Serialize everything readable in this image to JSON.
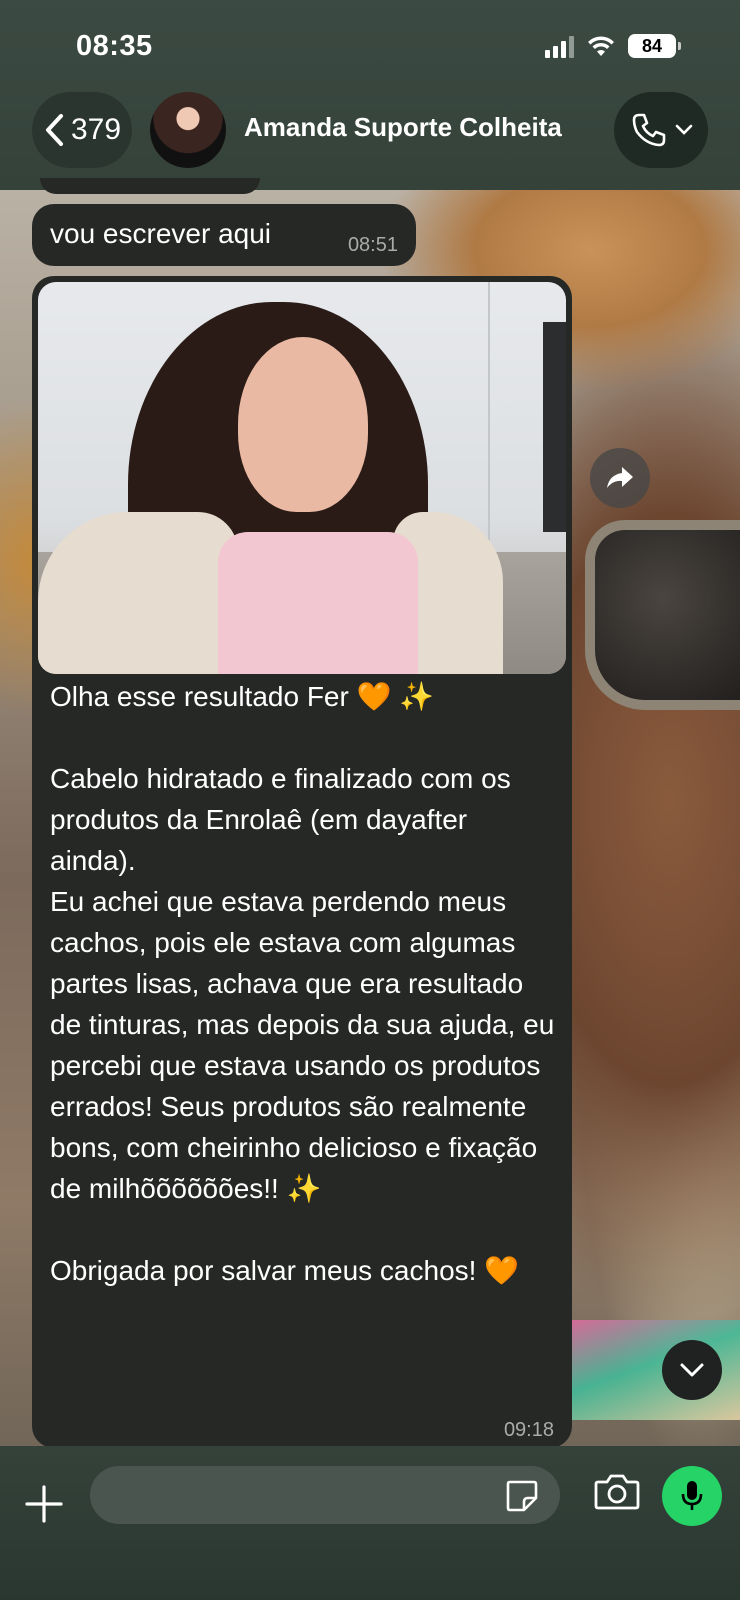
{
  "status_bar": {
    "time": "08:35",
    "battery": "84"
  },
  "header": {
    "back_count": "379",
    "contact_name": "Amanda Suporte Colheita"
  },
  "messages": [
    {
      "text": "vou escrever aqui",
      "time": "08:51"
    },
    {
      "has_photo": true,
      "text": "Olha esse resultado Fer 🧡 ✨\n\nCabelo hidratado e finalizado com os produtos da Enrolaê (em dayafter ainda).\nEu achei que estava perdendo meus cachos, pois ele estava com algumas partes lisas, achava que era resultado de tinturas, mas depois da sua ajuda, eu percebi que estava usando os produtos errados! Seus produtos são realmente bons, com cheirinho delicioso e fixação de milhõõõõõões!! ✨\n\nObrigada por salvar meus cachos! 🧡",
      "time": "09:18"
    }
  ],
  "input": {
    "placeholder": ""
  },
  "icons": {
    "back": "chevron-left-icon",
    "call": "phone-icon",
    "forward": "forward-icon",
    "scroll": "chevron-down-icon",
    "attach": "plus-icon",
    "sticker": "sticker-icon",
    "camera": "camera-icon",
    "mic": "microphone-icon"
  },
  "colors": {
    "mic_green": "#25d366",
    "bubble": "#262826",
    "bar": "#34423a"
  }
}
